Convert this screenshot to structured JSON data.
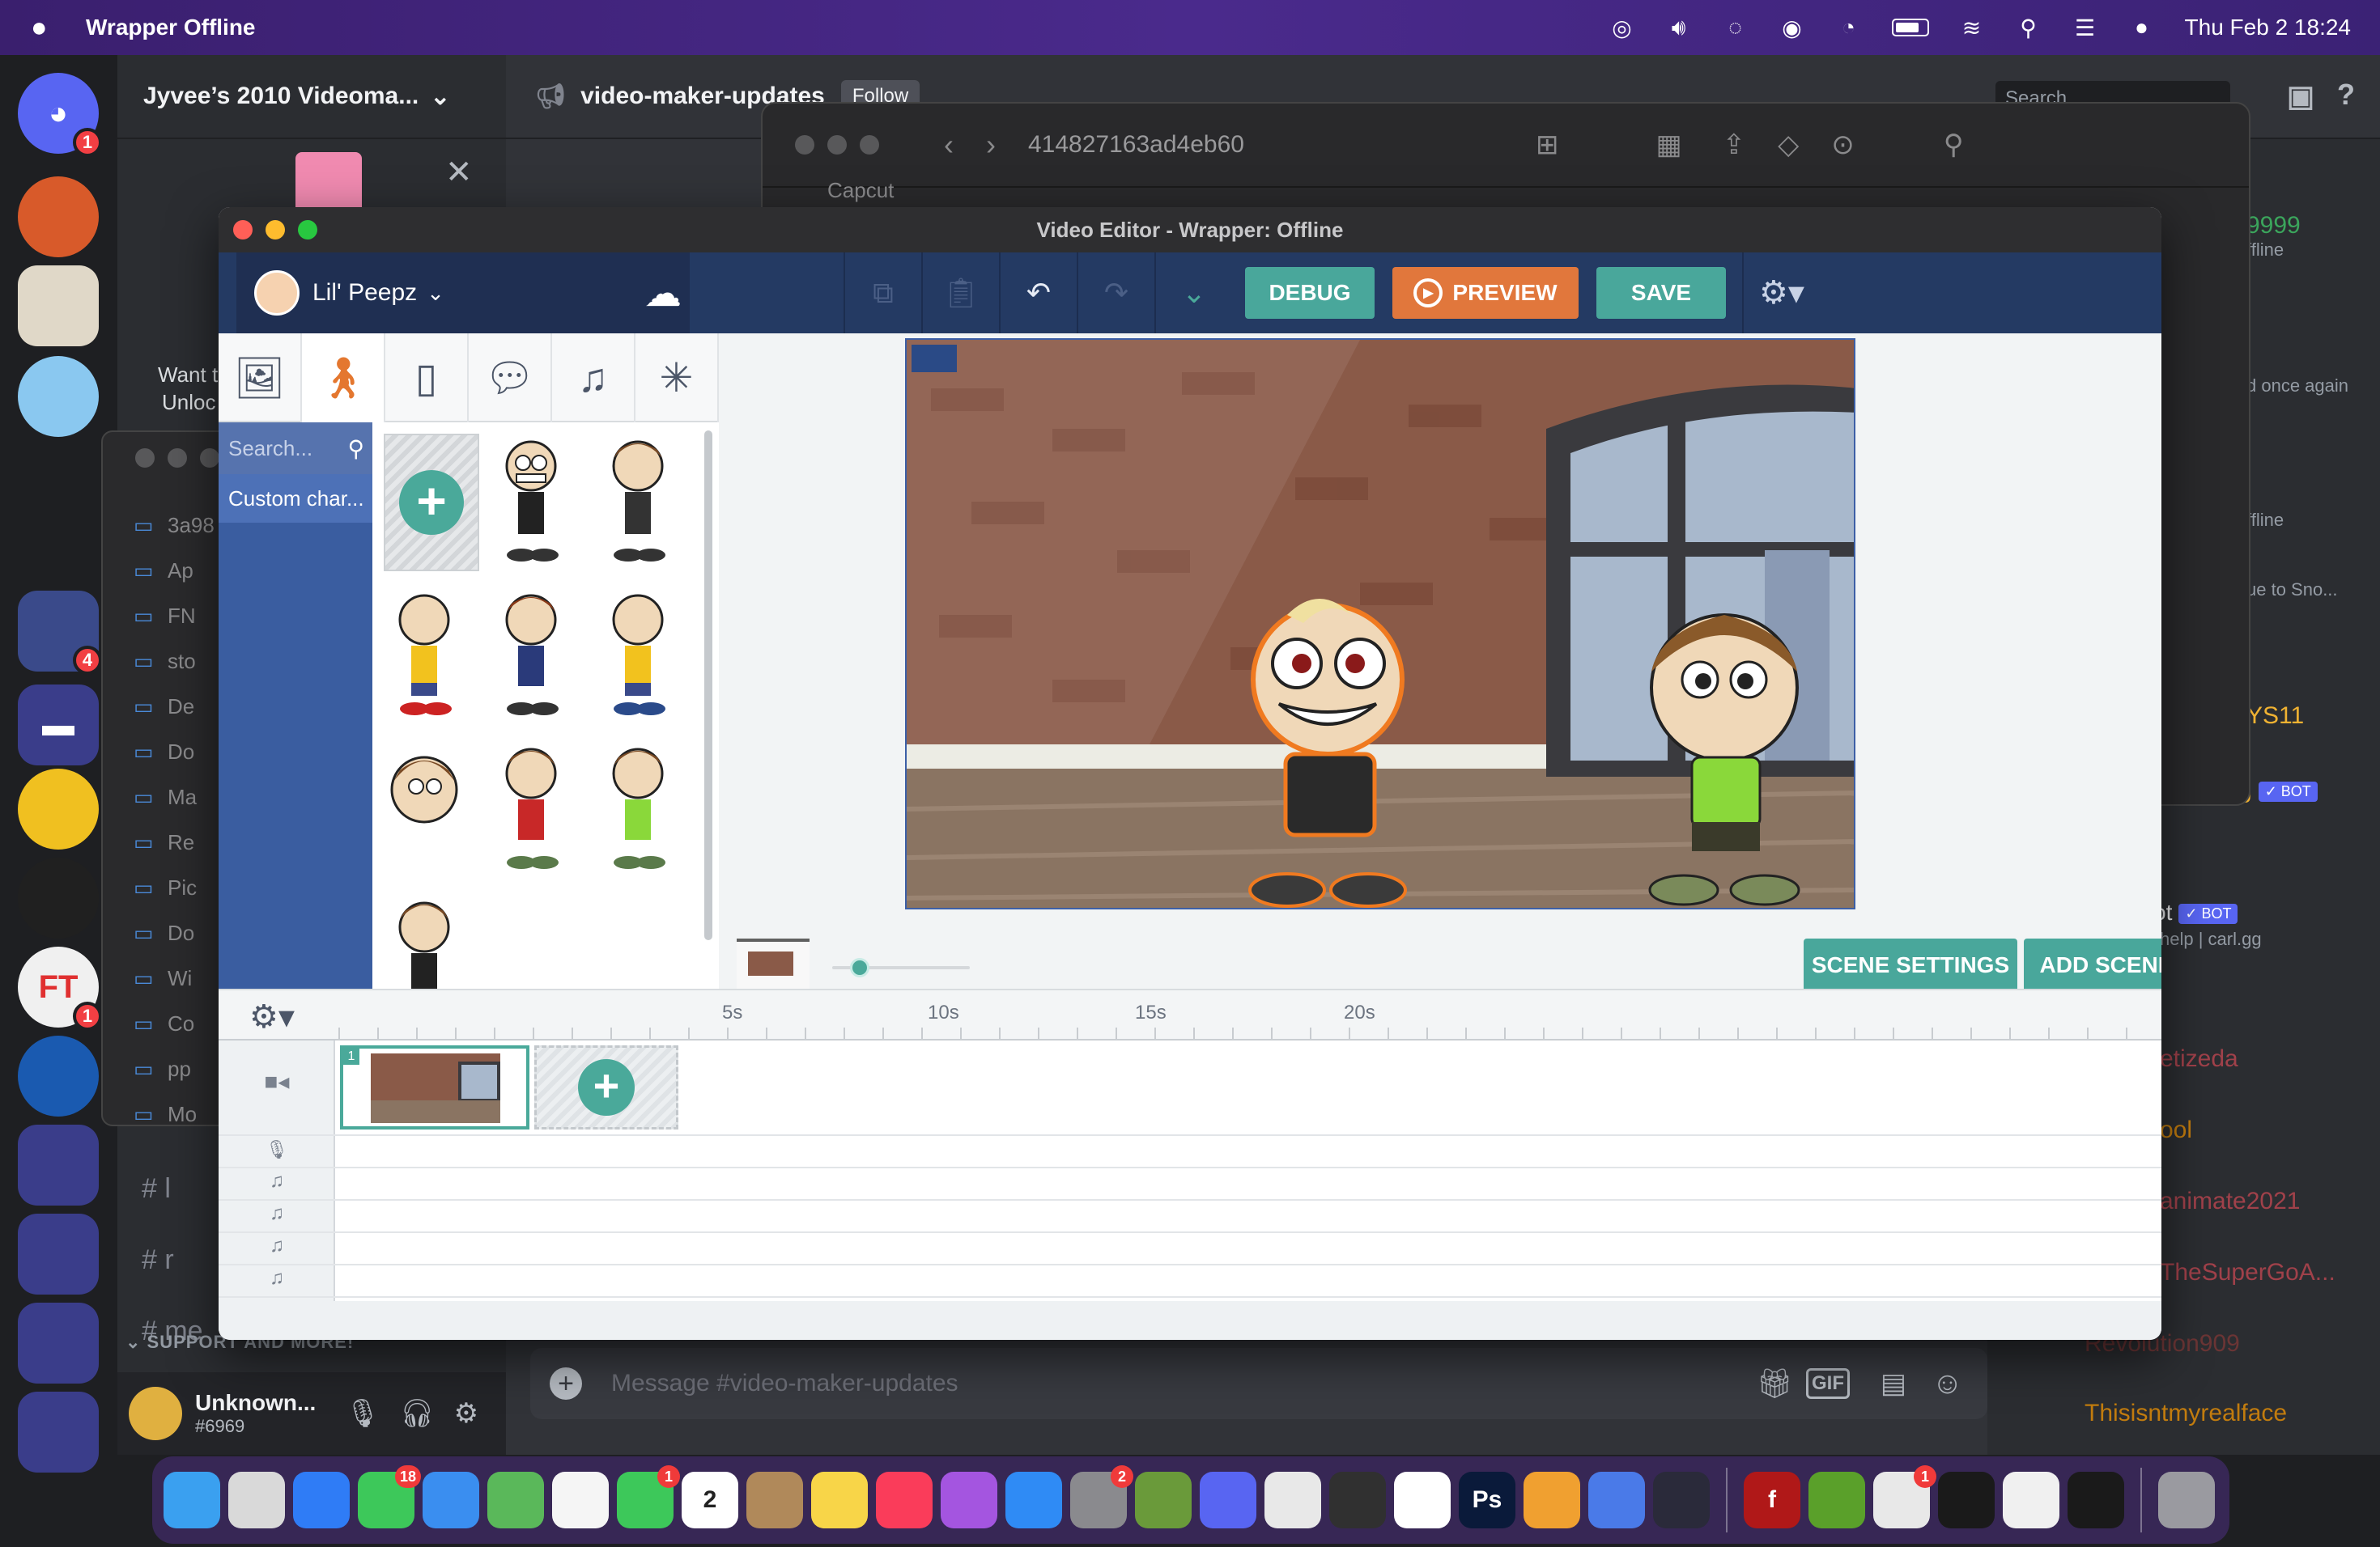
{
  "menubar": {
    "app_name": "Wrapper Offline",
    "datetime": "Thu Feb 2  18:24"
  },
  "discord": {
    "server_name": "Jyvee’s 2010 Videoma...",
    "channel_name": "video-maker-updates",
    "follow_label": "Follow",
    "search_placeholder": "Search",
    "channels": [
      "l",
      "r",
      "me"
    ],
    "support_header": "SUPPORT AND MORE!",
    "user": {
      "name": "Unknown...",
      "tag": "#6969"
    },
    "message_placeholder": "Message #video-maker-updates",
    "promo_text_1": "Want t",
    "promo_text_2": "Unloc",
    "members": [
      {
        "name": "9999",
        "color": "#3ba55c"
      },
      {
        "name": "ffline",
        "color": "#949ba4"
      },
      {
        "name": "d once again",
        "color": "#949ba4"
      },
      {
        "name": "ffline",
        "color": "#949ba4"
      },
      {
        "name": "ue to Sno...",
        "color": "#949ba4"
      },
      {
        "name": "YS11",
        "color": "#f0b232"
      },
      {
        "name": "g",
        "color": "#f0b232",
        "bot": "✓ BOT"
      },
      {
        "name": "ot",
        "color": "#f2f3f5",
        "bot": "✓ BOT"
      },
      {
        "name": "help | carl.gg",
        "color": "#949ba4"
      },
      {
        "name": "etizeda",
        "color": "#a0414a"
      },
      {
        "name": "ool",
        "color": "#c27c0e"
      },
      {
        "name": "animate2021",
        "color": "#a0414a"
      },
      {
        "name": "TheSuperGoA...",
        "color": "#a0414a"
      },
      {
        "name": "Revolution909",
        "color": "#6b3535"
      },
      {
        "name": "Thisisntmyrealface",
        "color": "#c27c0e"
      }
    ],
    "server_badges": [
      "1",
      "4",
      "1"
    ]
  },
  "finder": {
    "path": "414827163ad4eb60",
    "partial_item": "Capcut",
    "side_items": [
      "3a98",
      "Ap",
      "FN",
      "sto",
      "De",
      "Do",
      "Ma",
      "Re",
      "Pic",
      "Do",
      "Wi",
      "Co",
      "pp",
      "Mo"
    ]
  },
  "editor": {
    "window_title": "Video Editor - Wrapper: Offline",
    "theme_name": "Lil' Peepz",
    "buttons": {
      "debug": "DEBUG",
      "preview": "PREVIEW",
      "save": "SAVE",
      "scene_settings": "SCENE SETTINGS",
      "add_scene": "ADD SCENE"
    },
    "asset_tabs": [
      "backgrounds",
      "characters",
      "props",
      "text",
      "sounds",
      "effects"
    ],
    "active_tab": "characters",
    "search_placeholder": "Search...",
    "folder_label": "Custom char...",
    "timeline": {
      "ticks": [
        "5s",
        "10s",
        "15s",
        "20s"
      ],
      "scene_number": "1"
    },
    "zoom_level": 0.15
  },
  "colors": {
    "editor_header": "#243a63",
    "accent_green": "#49a79b",
    "accent_orange": "#e1773c"
  },
  "dock": {
    "apps": [
      {
        "name": "finder",
        "color": "#3aa0f0"
      },
      {
        "name": "launchpad",
        "color": "#d9d9d9"
      },
      {
        "name": "safari",
        "color": "#2f7cf6"
      },
      {
        "name": "messages",
        "color": "#3dc85a",
        "badge": "18"
      },
      {
        "name": "mail",
        "color": "#3a8ef0"
      },
      {
        "name": "maps",
        "color": "#5ab85a"
      },
      {
        "name": "photos",
        "color": "#f5f5f5"
      },
      {
        "name": "facetime",
        "color": "#3dc85a",
        "badge": "1"
      },
      {
        "name": "calendar",
        "color": "#ffffff",
        "label": "2"
      },
      {
        "name": "contacts",
        "color": "#b0895a"
      },
      {
        "name": "notes",
        "color": "#f8d548"
      },
      {
        "name": "music",
        "color": "#fa3c5a"
      },
      {
        "name": "podcasts",
        "color": "#a455e0"
      },
      {
        "name": "app-store",
        "color": "#2f8bf5"
      },
      {
        "name": "system-settings",
        "color": "#8a8a8e",
        "badge": "2"
      },
      {
        "name": "minecraft",
        "color": "#6a9a3a"
      },
      {
        "name": "discord",
        "color": "#5865f2"
      },
      {
        "name": "chrome",
        "color": "#e8e8e8"
      },
      {
        "name": "obs",
        "color": "#303030"
      },
      {
        "name": "capcut",
        "color": "#ffffff"
      },
      {
        "name": "photoshop",
        "color": "#0a1a3a",
        "label": "Ps"
      },
      {
        "name": "goanimate",
        "color": "#f0a030"
      },
      {
        "name": "chromium",
        "color": "#4a7ae8"
      },
      {
        "name": "electron",
        "color": "#2a2a3a"
      }
    ],
    "apps_right": [
      {
        "name": "flash",
        "color": "#b01818",
        "label": "f"
      },
      {
        "name": "utorrent",
        "color": "#5aa02a"
      },
      {
        "name": "chrome-canary",
        "color": "#e8e8e8",
        "badge": "1"
      },
      {
        "name": "terminal",
        "color": "#1a1a1a"
      },
      {
        "name": "textedit",
        "color": "#f0f0f0"
      },
      {
        "name": "exec",
        "color": "#1a1a1a"
      }
    ]
  }
}
